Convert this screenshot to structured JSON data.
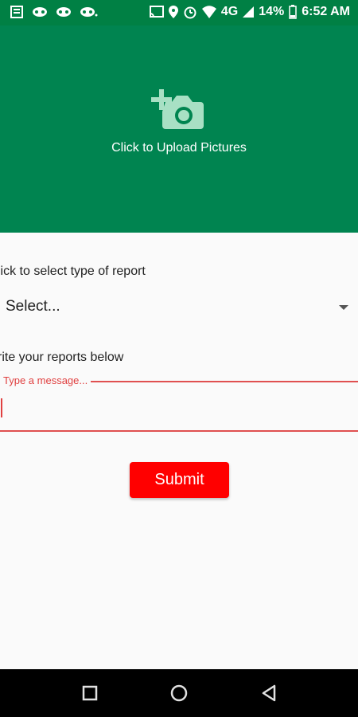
{
  "status_bar": {
    "network": "4G",
    "battery": "14%",
    "time": "6:52 AM"
  },
  "upload": {
    "label": "Click to Upload Pictures",
    "icon": "add-a-photo-icon"
  },
  "form": {
    "report_type_label": "lick to select type of report",
    "report_type_value": "Select...",
    "reports_label": "rite your reports below",
    "message_placeholder": "Type a message...",
    "message_value": "",
    "submit_label": "Submit"
  },
  "colors": {
    "header_green": "#008450",
    "status_green": "#008044",
    "submit_red": "#ff0000",
    "error_red": "#e05050"
  },
  "nav": {
    "recents_icon": "square-icon",
    "home_icon": "circle-icon",
    "back_icon": "triangle-back-icon"
  }
}
